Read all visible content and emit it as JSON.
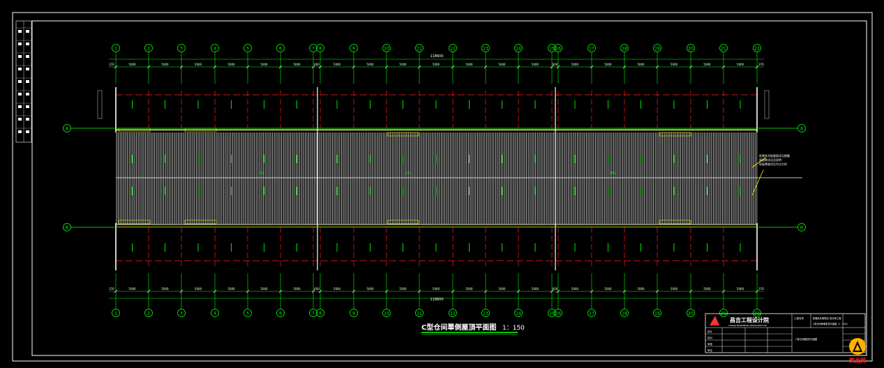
{
  "drawing": {
    "title": "C型仓间單側屋頂平面图",
    "scale": "1：150",
    "total_dimension": "118600",
    "grid_numbers": [
      "1",
      "2",
      "3",
      "4",
      "5",
      "6",
      "7",
      "8",
      "9",
      "10",
      "11",
      "12",
      "13",
      "14",
      "15",
      "16",
      "17",
      "18",
      "19",
      "20",
      "21",
      "22"
    ],
    "grid_letters": [
      "A",
      "B"
    ],
    "bay_dims": [
      "5000",
      "5000",
      "5000",
      "5000",
      "5000",
      "5000",
      "5000",
      "5000",
      "5000",
      "5000",
      "5000",
      "5000",
      "5000",
      "5000",
      "5000",
      "5000",
      "5000",
      "5000",
      "5000",
      "5000",
      "5000"
    ],
    "end_dim_left": "370",
    "end_dim_right": "370",
    "gap_dim": "600",
    "roof_slope_label": "2%",
    "callout_text": [
      "彩钢夹芯板屋面详见图集",
      "屋面做法见总说明",
      "彩板厚度详见节点大样"
    ]
  },
  "title_block": {
    "company": "昌吉工程设计院",
    "company_en": "CHANGJI ENGINEERING DESIGN INSTITUTE",
    "project_label": "工程名称",
    "project_name": "新疆某仓储项目C型仓间工程",
    "sheet_name": "C型仓间屋顶平面图",
    "sheet_sub": "C型仓间單側屋頂平面图（1：150）",
    "rows": [
      "设计",
      "校对",
      "审核",
      "审定"
    ],
    "logo_text": "筑龙网"
  },
  "colors": {
    "grid_line": "#00ff00",
    "axis_red": "#ff2020",
    "wall_white": "#ffffff",
    "roof_gray": "#b8b8b8",
    "yellow": "#ffff00",
    "title_green": "#00ff00",
    "frame": "#ffffff"
  }
}
